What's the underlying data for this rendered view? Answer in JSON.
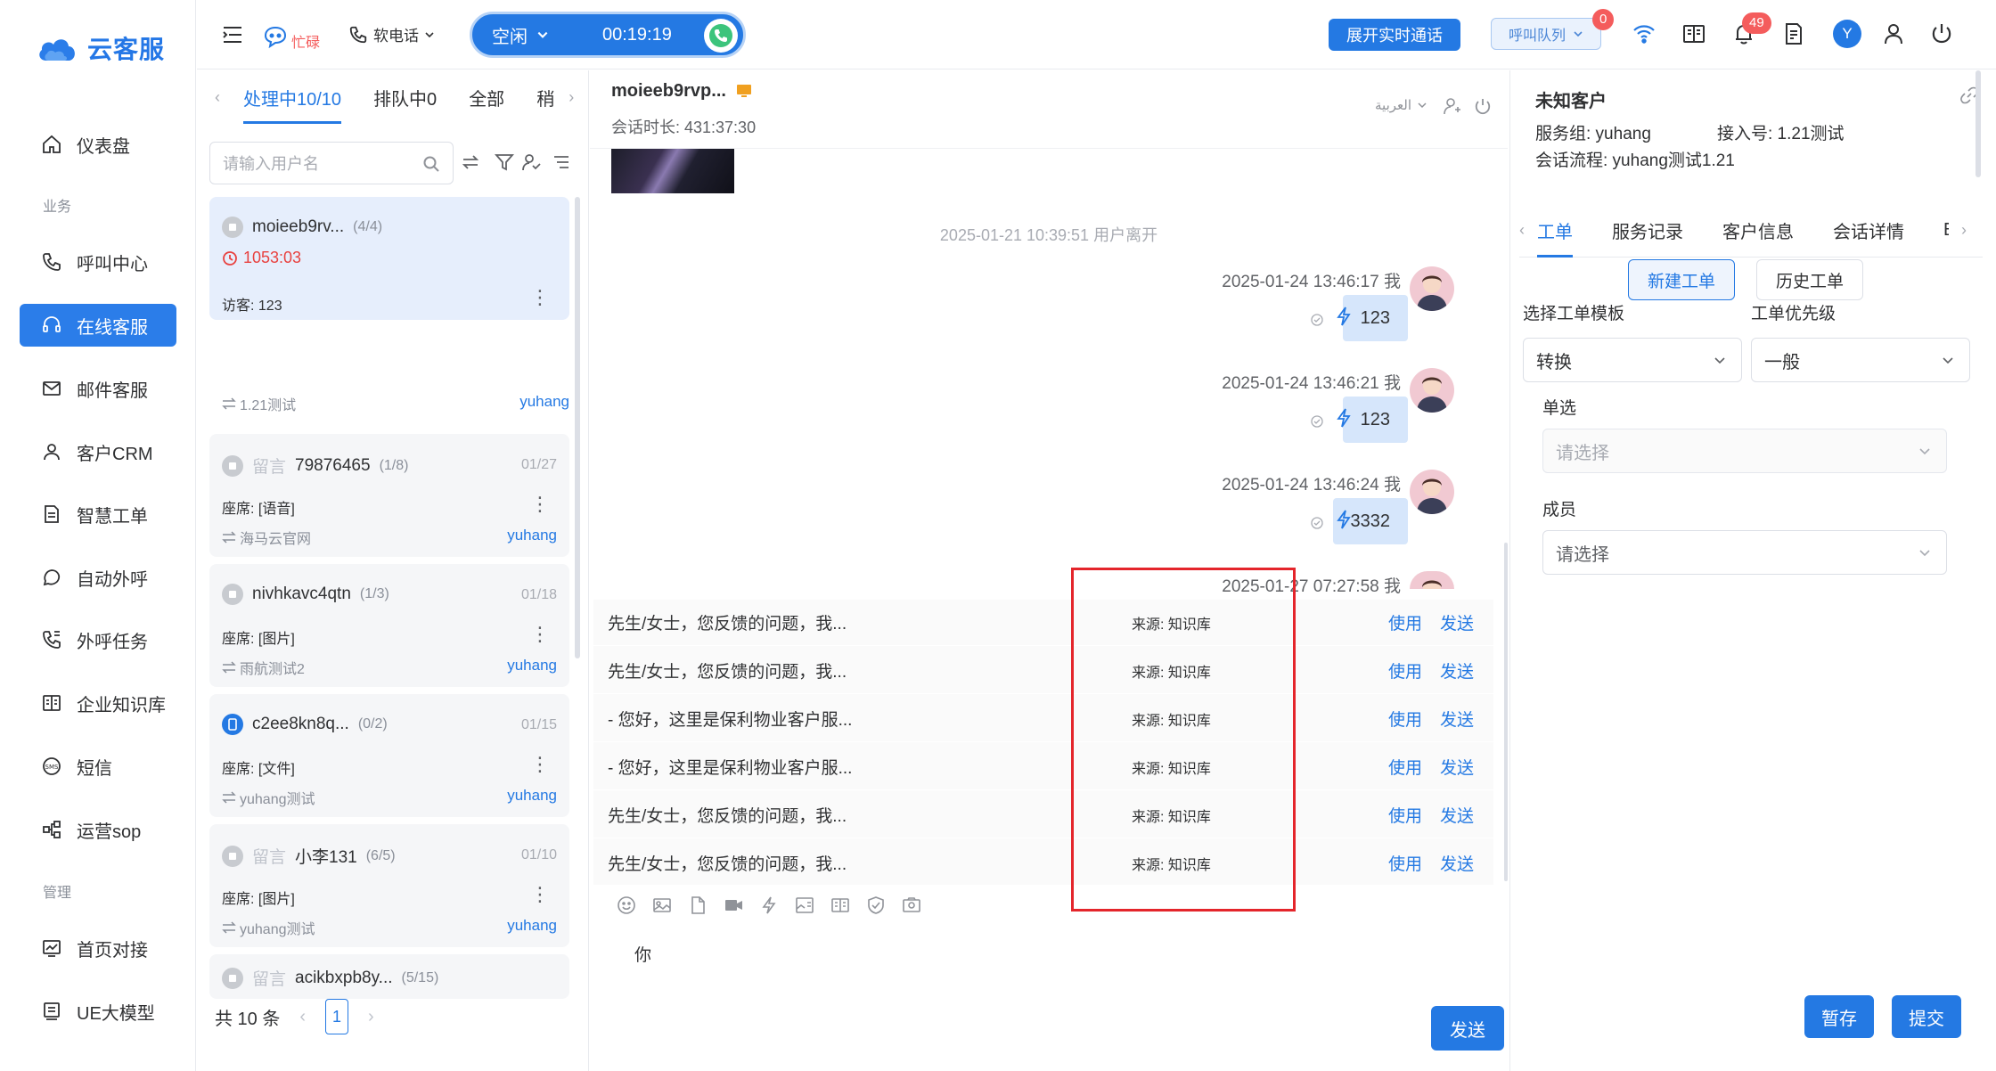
{
  "brand": {
    "name": "云客服"
  },
  "nav": {
    "items": [
      {
        "label": "仪表盘",
        "icon": "home-icon"
      },
      {
        "label": "呼叫中心",
        "icon": "phone-icon"
      },
      {
        "label": "在线客服",
        "icon": "headset-icon"
      },
      {
        "label": "邮件客服",
        "icon": "mail-icon"
      },
      {
        "label": "客户CRM",
        "icon": "user-icon"
      },
      {
        "label": "智慧工单",
        "icon": "document-icon"
      },
      {
        "label": "自动外呼",
        "icon": "whatsapp-icon"
      },
      {
        "label": "外呼任务",
        "icon": "phone-task-icon"
      },
      {
        "label": "企业知识库",
        "icon": "book-icon"
      },
      {
        "label": "短信",
        "icon": "sms-icon"
      },
      {
        "label": "运营sop",
        "icon": "flow-icon"
      },
      {
        "label": "首页对接",
        "icon": "chart-icon"
      },
      {
        "label": "UE大模型",
        "icon": "model-icon"
      }
    ],
    "sections": {
      "business": "业务",
      "management": "管理"
    }
  },
  "topbar": {
    "busy_label": "忙碌",
    "softphone_label": "软电话",
    "status_label": "空闲",
    "timer": "00:19:19",
    "realtime_btn": "展开实时通话",
    "queue_btn": "呼叫队列",
    "queue_badge": "0",
    "notify_badge": "49",
    "user_initial": "Y"
  },
  "list": {
    "tabs": [
      "处理中10/10",
      "排队中0",
      "全部",
      "稍"
    ],
    "search_placeholder": "请输入用户名",
    "conversations": [
      {
        "name": "moieeb9rv...",
        "count": "(4/4)",
        "timer": "1053:03",
        "line2": "访客: 123",
        "group": "1.21测试",
        "agent": "yuhang",
        "date": "",
        "prefix": ""
      },
      {
        "name": "79876465",
        "count": "(1/8)",
        "timer": "",
        "line2": "座席: [语音]",
        "group": "海马云官网",
        "agent": "yuhang",
        "date": "01/27",
        "prefix": "留言"
      },
      {
        "name": "nivhkavc4qtn",
        "count": "(1/3)",
        "timer": "",
        "line2": "座席: [图片]",
        "group": "雨航测试2",
        "agent": "yuhang",
        "date": "01/18",
        "prefix": ""
      },
      {
        "name": "c2ee8kn8q...",
        "count": "(0/2)",
        "timer": "",
        "line2": "座席: [文件]",
        "group": "yuhang测试",
        "agent": "yuhang",
        "date": "01/15",
        "prefix": ""
      },
      {
        "name": "小李131",
        "count": "(6/5)",
        "timer": "",
        "line2": "座席: [图片]",
        "group": "yuhang测试",
        "agent": "yuhang",
        "date": "01/10",
        "prefix": "留言"
      },
      {
        "name": "acikbxpb8y...",
        "count": "(5/15)",
        "timer": "",
        "line2": "",
        "group": "",
        "agent": "",
        "date": "",
        "prefix": "留言"
      }
    ],
    "total": "共 10 条",
    "page": "1"
  },
  "chat": {
    "title": "moieeb9rvp...",
    "duration": "会话时长: 431:37:30",
    "lang": "العربية",
    "system_msg": "2025-01-21 10:39:51 用户离开",
    "messages": [
      {
        "meta": "2025-01-24 13:46:17 我",
        "text": "123"
      },
      {
        "meta": "2025-01-24 13:46:21 我",
        "text": "123"
      },
      {
        "meta": "2025-01-24 13:46:24 我",
        "text": "3332"
      },
      {
        "meta": "2025-01-27 07:27:58 我",
        "text": ""
      }
    ],
    "kb_rows": [
      {
        "text": "先生/女士，您反馈的问题，我...",
        "source": "来源: 知识库"
      },
      {
        "text": "先生/女士，您反馈的问题，我...",
        "source": "来源: 知识库"
      },
      {
        "text": "- 您好，这里是保利物业客户服...",
        "source": "来源: 知识库"
      },
      {
        "text": "- 您好，这里是保利物业客户服...",
        "source": "来源: 知识库"
      },
      {
        "text": "先生/女士，您反馈的问题，我...",
        "source": "来源: 知识库"
      },
      {
        "text": "先生/女士，您反馈的问题，我...",
        "source": "来源: 知识库"
      }
    ],
    "use_label": "使用",
    "send_label": "发送",
    "input_text": "你",
    "send_btn": "发送"
  },
  "right": {
    "title": "未知客户",
    "service_group": "服务组: yuhang",
    "access_no": "接入号: 1.21测试",
    "flow": "会话流程: yuhang测试1.21",
    "tabs": [
      "工单",
      "服务记录",
      "客户信息",
      "会话详情",
      "E"
    ],
    "new_ticket": "新建工单",
    "history_ticket": "历史工单",
    "template_label": "选择工单模板",
    "template_value": "转换",
    "priority_label": "工单优先级",
    "priority_value": "一般",
    "single_label": "单选",
    "single_placeholder": "请选择",
    "member_label": "成员",
    "member_placeholder": "请选择",
    "save_btn": "暂存",
    "submit_btn": "提交"
  },
  "colors": {
    "primary": "#2479e3",
    "badge": "#f45c5c",
    "highlight_box": "#e4252b"
  }
}
